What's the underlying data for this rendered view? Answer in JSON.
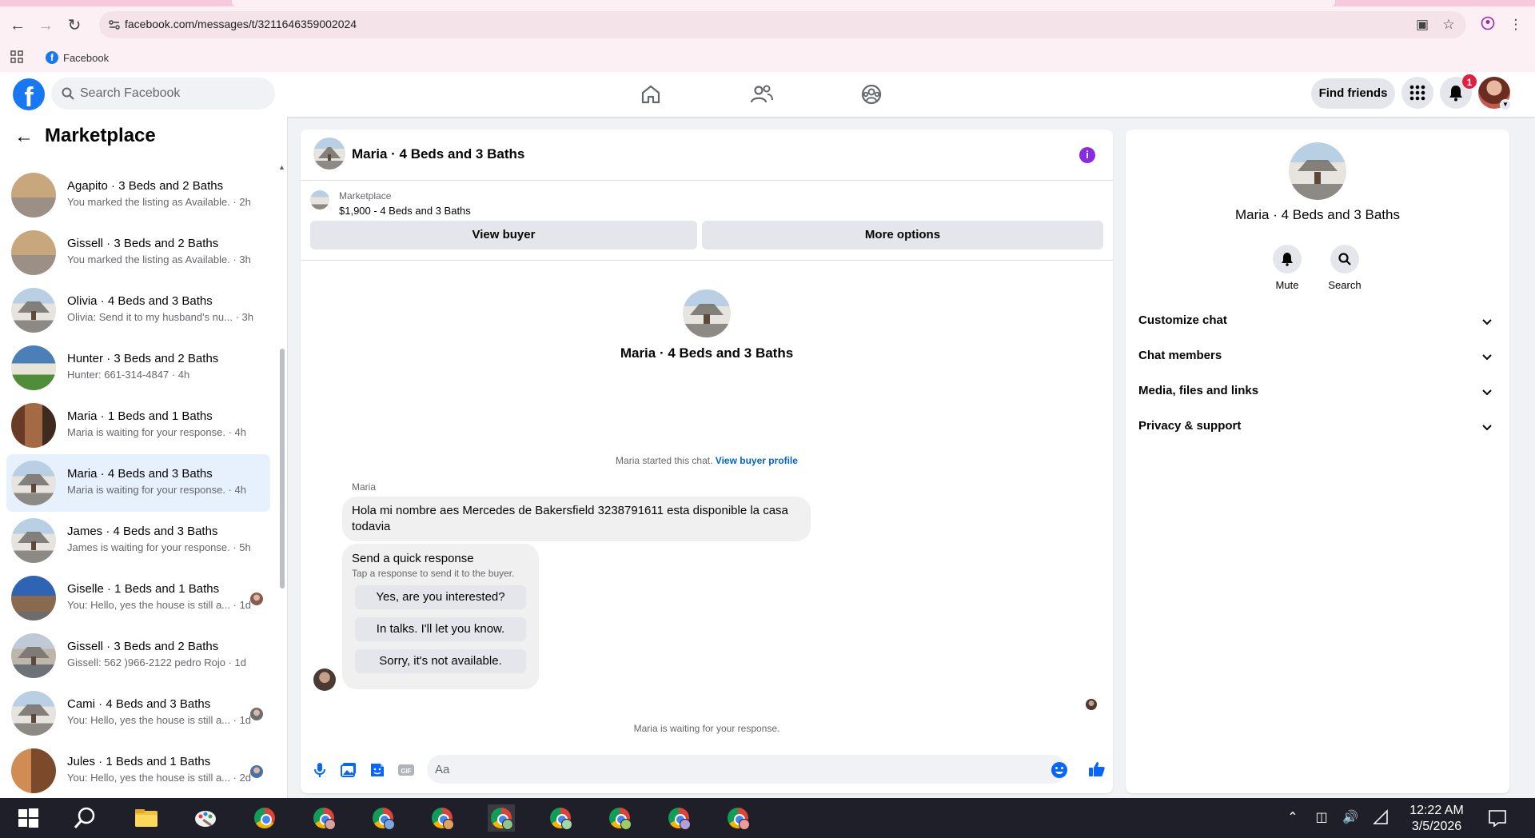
{
  "browser": {
    "url": "facebook.com/messages/t/3211646359002024",
    "bookmark_label": "Facebook"
  },
  "header": {
    "logo_letter": "f",
    "search_placeholder": "Search Facebook",
    "find_friends_label": "Find friends",
    "notification_count": "1"
  },
  "sidebar": {
    "title": "Marketplace",
    "conversations": [
      {
        "title": "Agapito · 3 Beds and 2 Baths",
        "subtitle": "You marked the listing as Available. · 2h",
        "thumb": "beige",
        "mini": false
      },
      {
        "title": "Gissell · 3 Beds and 2 Baths",
        "subtitle": "You marked the listing as Available. · 3h",
        "thumb": "beige",
        "mini": false
      },
      {
        "title": "Olivia · 4 Beds and 3 Baths",
        "subtitle": "Olivia: Send it to my husband's nu... · 3h",
        "thumb": "white",
        "mini": false
      },
      {
        "title": "Hunter · 3 Beds and 2 Baths",
        "subtitle": "Hunter: 661-314-4847 · 4h",
        "thumb": "green",
        "mini": false
      },
      {
        "title": "Maria · 1 Beds and 1 Baths",
        "subtitle": "Maria is waiting for your response. · 4h",
        "thumb": "brown",
        "mini": false
      },
      {
        "title": "Maria · 4 Beds and 3 Baths",
        "subtitle": "Maria is waiting for your response. · 4h",
        "thumb": "white",
        "mini": false,
        "selected": true
      },
      {
        "title": "James · 4 Beds and 3 Baths",
        "subtitle": "James is waiting for your response. · 5h",
        "thumb": "white",
        "mini": false
      },
      {
        "title": "Giselle · 1 Beds and 1 Baths",
        "subtitle": "You: Hello, yes the house is still a... · 1d",
        "thumb": "blue",
        "mini": true
      },
      {
        "title": "Gissell · 3 Beds and 2 Baths",
        "subtitle": "Gissell: 562 )966-2122 pedro Rojo · 1d",
        "thumb": "gray",
        "mini": false
      },
      {
        "title": "Cami · 4 Beds and 3 Baths",
        "subtitle": "You: Hello, yes the house is still a... · 1d",
        "thumb": "white",
        "mini": true
      },
      {
        "title": "Jules · 1 Beds and 1 Baths",
        "subtitle": "You: Hello, yes the house is still a... · 2d",
        "thumb": "wood",
        "mini": true
      }
    ]
  },
  "chat": {
    "title": "Maria · 4 Beds and 3 Baths",
    "listing_label": "Marketplace",
    "listing_price": "$1,900 - 4 Beds and 3 Baths",
    "view_buyer_label": "View buyer",
    "more_options_label": "More options",
    "intro_title": "Maria · 4 Beds and 3 Baths",
    "started_text": "Maria started this chat.",
    "view_buyer_profile_label": "View buyer profile",
    "sender_name": "Maria",
    "message_text": "Hola mi nombre aes Mercedes de Bakersfield 3238791611 esta disponible la casa todavia",
    "quick_title": "Send a quick response",
    "quick_subtitle": "Tap a response to send it to the buyer.",
    "quick_options": [
      "Yes, are you interested?",
      "In talks. I'll let you know.",
      "Sorry, it's not available."
    ],
    "waiting_text": "Maria is waiting for your response.",
    "composer_placeholder": "Aa"
  },
  "rpanel": {
    "title": "Maria · 4 Beds and 3 Baths",
    "mute_label": "Mute",
    "search_label": "Search",
    "sections": [
      "Customize chat",
      "Chat members",
      "Media, files and links",
      "Privacy & support"
    ]
  },
  "taskbar": {
    "time": "12:22 AM",
    "date": "3/5/2026"
  },
  "colors": {
    "brand": "#1877f2",
    "selected_row": "#e7f1fd",
    "info_icon": "#8a2be2",
    "badge": "#e41e3f"
  }
}
